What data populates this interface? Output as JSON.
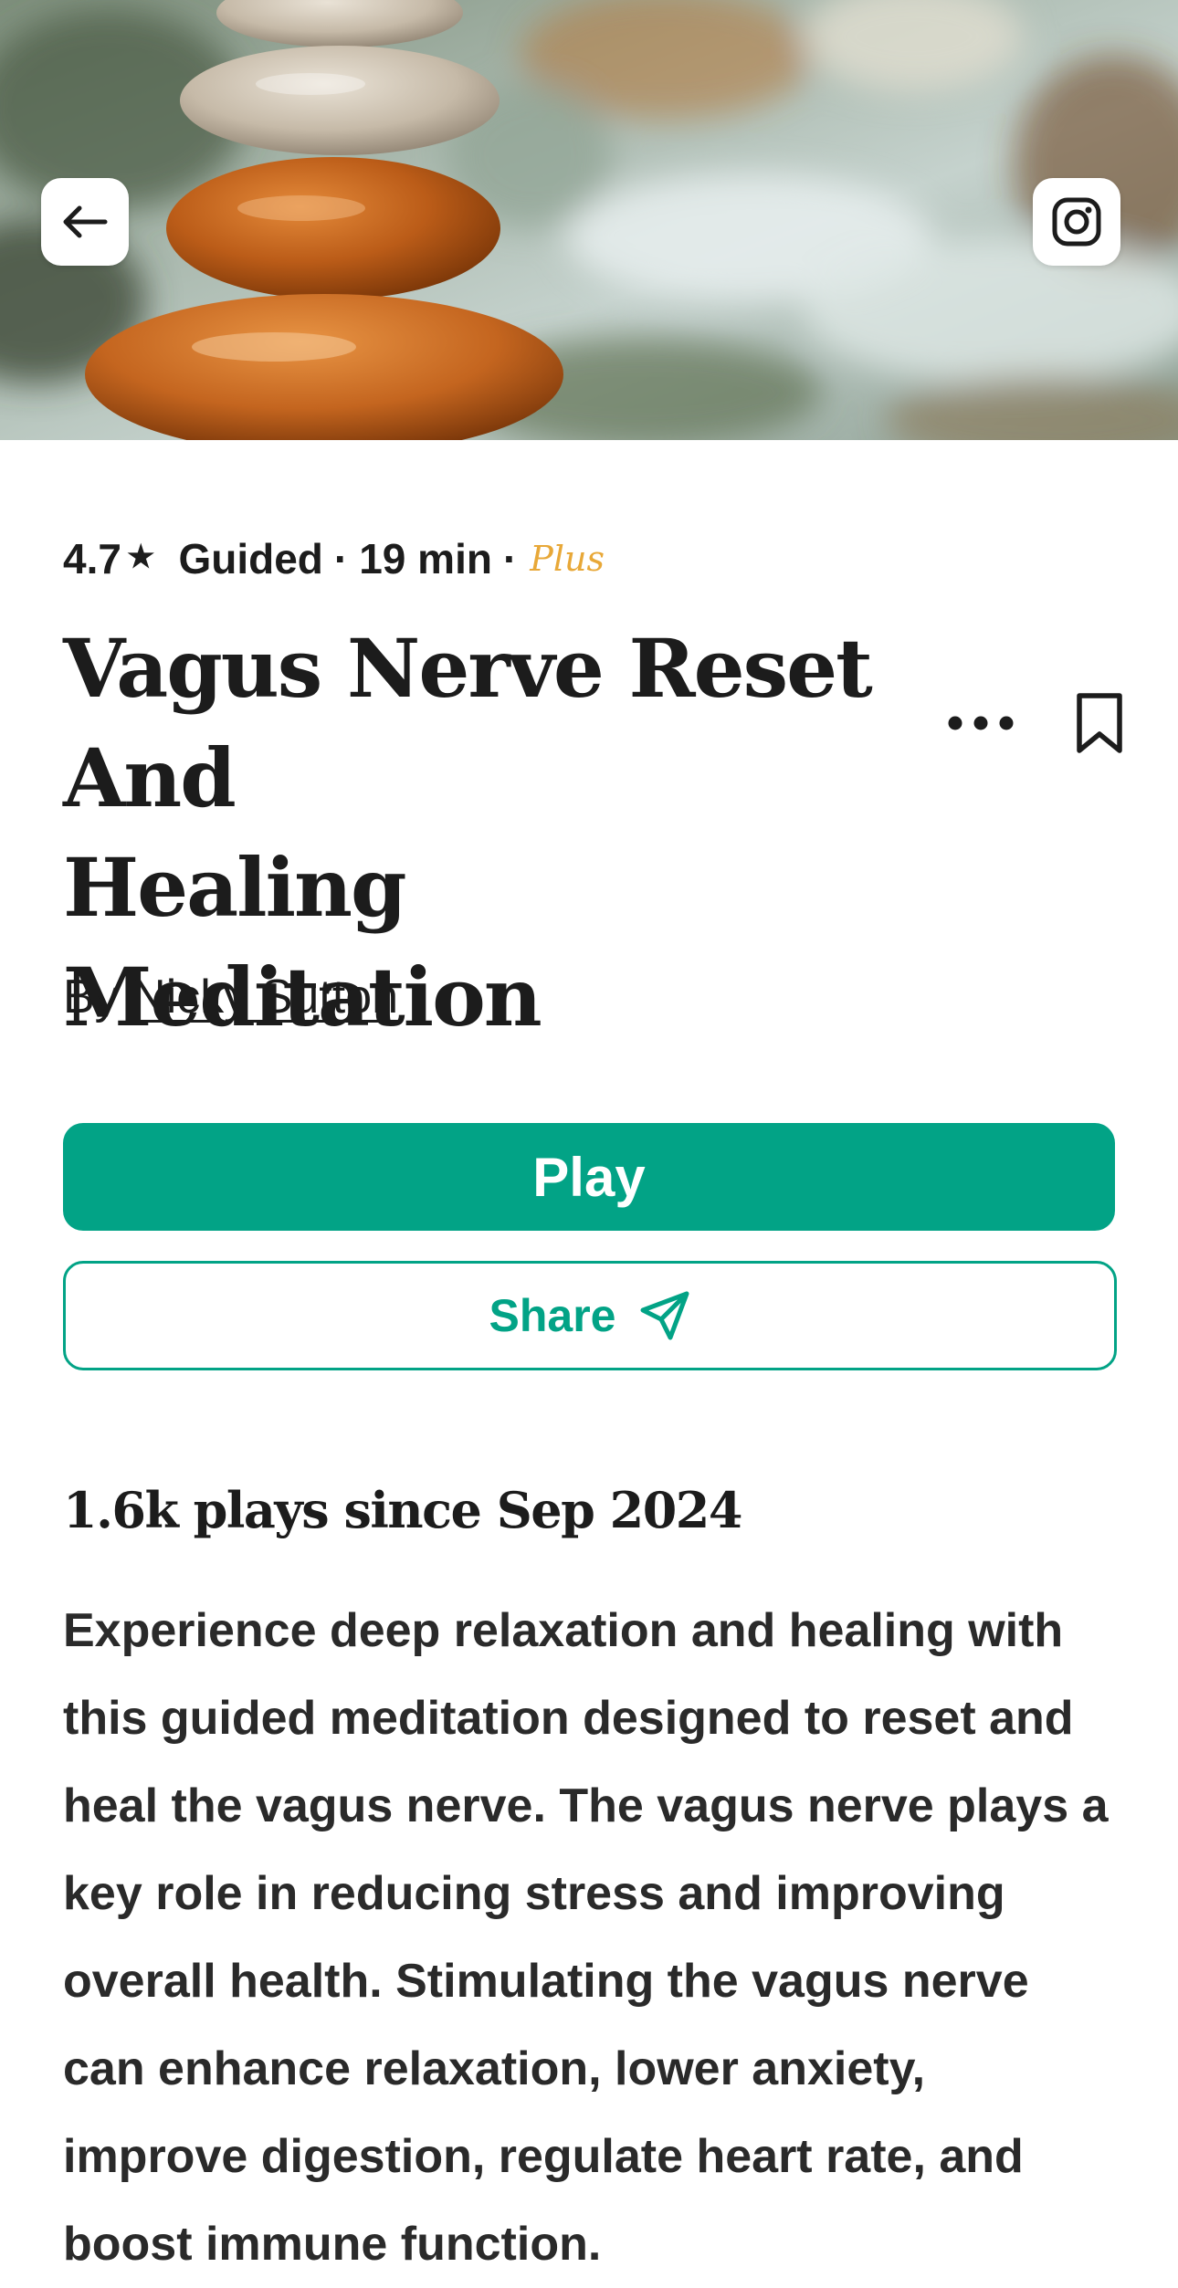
{
  "hero": {
    "back_icon": "arrow-left-icon",
    "share_icon": "instagram-icon",
    "image_subject": "stacked river stones"
  },
  "meta": {
    "rating": "4.7",
    "rating_icon": "star-icon",
    "type": "Guided",
    "separator": "·",
    "duration": "19 min",
    "tier": "Plus"
  },
  "title": {
    "line1": "Vagus Nerve Reset",
    "line2": "And",
    "line3": "Healing Meditation"
  },
  "actions": {
    "more_icon": "ellipsis-icon",
    "bookmark_icon": "bookmark-icon"
  },
  "byline": {
    "prefix": "By",
    "author": "Nicky Sutton"
  },
  "buttons": {
    "play_label": "Play",
    "share_label": "Share",
    "share_icon": "paper-plane-icon"
  },
  "stats": {
    "plays": "1.6k plays since Sep 2024"
  },
  "description": "Experience deep relaxation and healing with this guided meditation designed to reset and heal the vagus nerve. The vagus nerve plays a key role in reducing stress and improving overall health. Stimulating the vagus nerve can enhance relaxation, lower anxiety, improve digestion, regulate heart rate, and boost immune function.",
  "colors": {
    "accent": "#02a386",
    "plus": "#e8a838",
    "text": "#1c1c1c"
  }
}
